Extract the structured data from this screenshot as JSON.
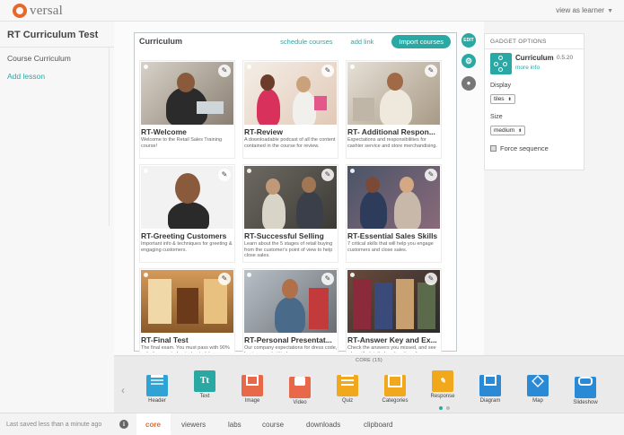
{
  "app": {
    "logo_text": "versal",
    "view_as": "view as learner"
  },
  "sidebar": {
    "course_title": "RT Curriculum Test",
    "items": [
      {
        "label": "Course Curriculum"
      },
      {
        "label": "Add lesson"
      }
    ]
  },
  "curriculum": {
    "title": "Curriculum",
    "schedule_label": "schedule courses",
    "add_link_label": "add link",
    "import_label": "Import courses",
    "cards": [
      {
        "title": "RT-Welcome",
        "desc": "Welcome to the Retail Sales Training course!"
      },
      {
        "title": "RT-Review",
        "desc": "A downloadable podcast of all the content contained in the course for review."
      },
      {
        "title": "RT- Additional Respon...",
        "desc": "Expectations and responsibilities for cashier service and store merchandising."
      },
      {
        "title": "RT-Greeting Customers",
        "desc": "Important info & techniques for greeting & engaging customers."
      },
      {
        "title": "RT-Successful Selling",
        "desc": "Learn about the 5 stages of retail buying from the customer's point of view to help close sales."
      },
      {
        "title": "RT-Essential Sales Skills",
        "desc": "7 critical skills that will help you engage customers and close sales."
      },
      {
        "title": "RT-Final Test",
        "desc": "The final exam. You must pass with 90% or better, so study, study, study!"
      },
      {
        "title": "RT-Personal Presentat...",
        "desc": "Our company expectations for dress code, hygiene, and attitude."
      },
      {
        "title": "RT-Answer Key and Ex...",
        "desc": "Check the answers you missed, and see why with detailed explanations for"
      }
    ]
  },
  "side_buttons": {
    "edit_label": "EDIT"
  },
  "gadget_options": {
    "header": "GADGET OPTIONS",
    "name": "Curriculum",
    "version": "0.5.20",
    "more_info": "more info",
    "display_label": "Display",
    "display_value": "tiles",
    "size_label": "Size",
    "size_value": "medium",
    "force_label": "Force sequence"
  },
  "tray": {
    "label": "CORE (15)",
    "tools": [
      {
        "label": "Header",
        "glyph": "",
        "color": "#2ea3d6"
      },
      {
        "label": "Text",
        "glyph": "Tt",
        "color": "#2aa8a3"
      },
      {
        "label": "Image",
        "glyph": "",
        "color": "#e8684a"
      },
      {
        "label": "Video",
        "glyph": "",
        "color": "#e8684a"
      },
      {
        "label": "Quiz",
        "glyph": "",
        "color": "#f2a81d"
      },
      {
        "label": "Categories",
        "glyph": "",
        "color": "#f2a81d"
      },
      {
        "label": "Response",
        "glyph": "",
        "color": "#f2a81d"
      },
      {
        "label": "Diagram",
        "glyph": "",
        "color": "#2a8ad6"
      },
      {
        "label": "Map",
        "glyph": "",
        "color": "#2a8ad6"
      },
      {
        "label": "Slideshow",
        "glyph": "",
        "color": "#2a8ad6"
      }
    ]
  },
  "bottom": {
    "saved": "Last saved less than a minute ago",
    "tabs": [
      "core",
      "viewers",
      "labs",
      "course",
      "downloads",
      "clipboard"
    ]
  },
  "colors": {
    "accent": "#2aa8a3",
    "active_tab": "#e8682a"
  }
}
